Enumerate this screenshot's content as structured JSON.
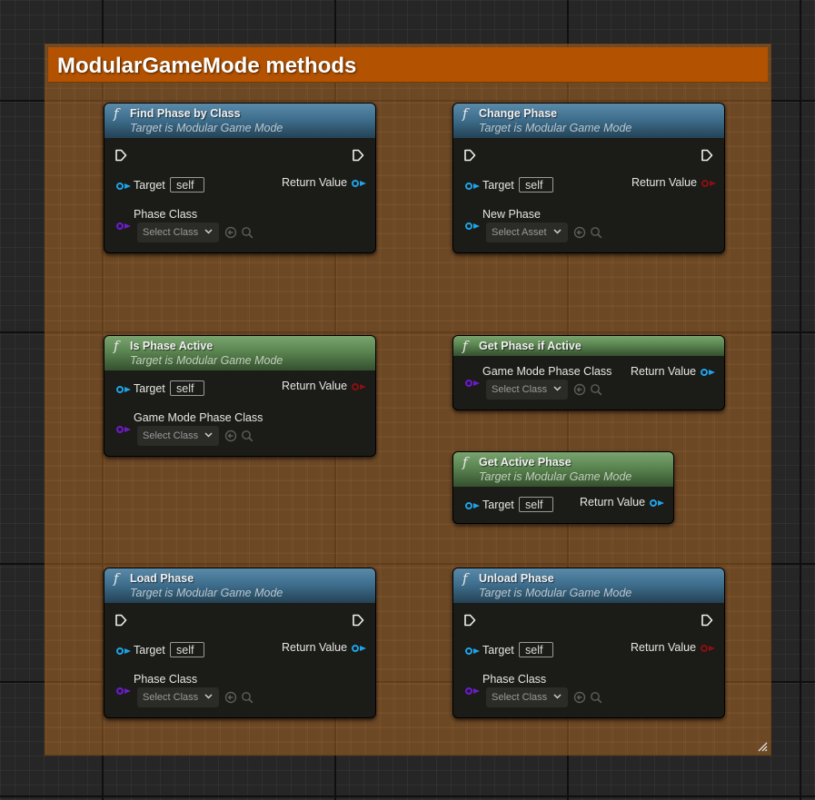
{
  "comment": {
    "title": "ModularGameMode methods"
  },
  "colors": {
    "comment_header": "#b35200",
    "function_header_blue": "#3f6f8e",
    "pure_header_green": "#5a8450",
    "pin_object_blue": "#1ea3e6",
    "pin_class_purple": "#6a1fc4",
    "pin_bool_red": "#8a0f14"
  },
  "nodes": {
    "find_phase": {
      "title": "Find Phase by Class",
      "subtitle": "Target is Modular Game Mode",
      "target_label": "Target",
      "target_value": "self",
      "return_label": "Return Value",
      "param_label": "Phase Class",
      "select_label": "Select Class"
    },
    "change_phase": {
      "title": "Change Phase",
      "subtitle": "Target is Modular Game Mode",
      "target_label": "Target",
      "target_value": "self",
      "return_label": "Return Value",
      "param_label": "New Phase",
      "select_label": "Select Asset"
    },
    "is_phase_active": {
      "title": "Is Phase Active",
      "subtitle": "Target is Modular Game Mode",
      "target_label": "Target",
      "target_value": "self",
      "return_label": "Return Value",
      "param_label": "Game Mode Phase Class",
      "select_label": "Select Class"
    },
    "get_phase_if_active": {
      "title": "Get Phase if Active",
      "param_label": "Game Mode Phase Class",
      "return_label": "Return Value",
      "select_label": "Select Class"
    },
    "get_active_phase": {
      "title": "Get Active Phase",
      "subtitle": "Target is Modular Game Mode",
      "target_label": "Target",
      "target_value": "self",
      "return_label": "Return Value"
    },
    "load_phase": {
      "title": "Load Phase",
      "subtitle": "Target is Modular Game Mode",
      "target_label": "Target",
      "target_value": "self",
      "return_label": "Return Value",
      "param_label": "Phase Class",
      "select_label": "Select Class"
    },
    "unload_phase": {
      "title": "Unload Phase",
      "subtitle": "Target is Modular Game Mode",
      "target_label": "Target",
      "target_value": "self",
      "return_label": "Return Value",
      "param_label": "Phase Class",
      "select_label": "Select Class"
    }
  },
  "icons": {
    "function": "f",
    "exec_pin": "exec-arrow-icon",
    "use_selected": "arrow-circle-left-icon",
    "browse": "magnifier-icon",
    "dropdown": "chevron-down-icon",
    "resize": "resize-grip-icon"
  }
}
